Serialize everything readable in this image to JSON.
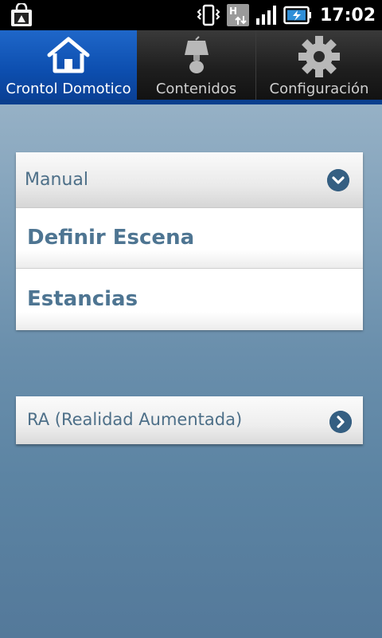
{
  "status_bar": {
    "time": "17:02",
    "icons": [
      "shopping-bag-notification-icon",
      "vibrate-icon",
      "hsdpa-data-icon",
      "signal-icon",
      "battery-charging-icon"
    ],
    "network_label": "H"
  },
  "tabs": [
    {
      "label": "Crontol Domotico",
      "icon": "home-icon",
      "selected": true
    },
    {
      "label": "Contenidos",
      "icon": "lamp-icon",
      "selected": false
    },
    {
      "label": "Configuración",
      "icon": "gear-icon",
      "selected": false
    }
  ],
  "main_panel": {
    "header_label": "Manual",
    "header_icon": "chevron-down-icon",
    "items": [
      {
        "label": "Definir Escena"
      },
      {
        "label": "Estancias"
      }
    ]
  },
  "ra_panel": {
    "label": "RA (Realidad Aumentada)",
    "icon": "chevron-right-icon"
  },
  "colors": {
    "accent_blue": "#0d4fb0",
    "text_blue": "#4e7592",
    "button_blue": "#355f82"
  }
}
